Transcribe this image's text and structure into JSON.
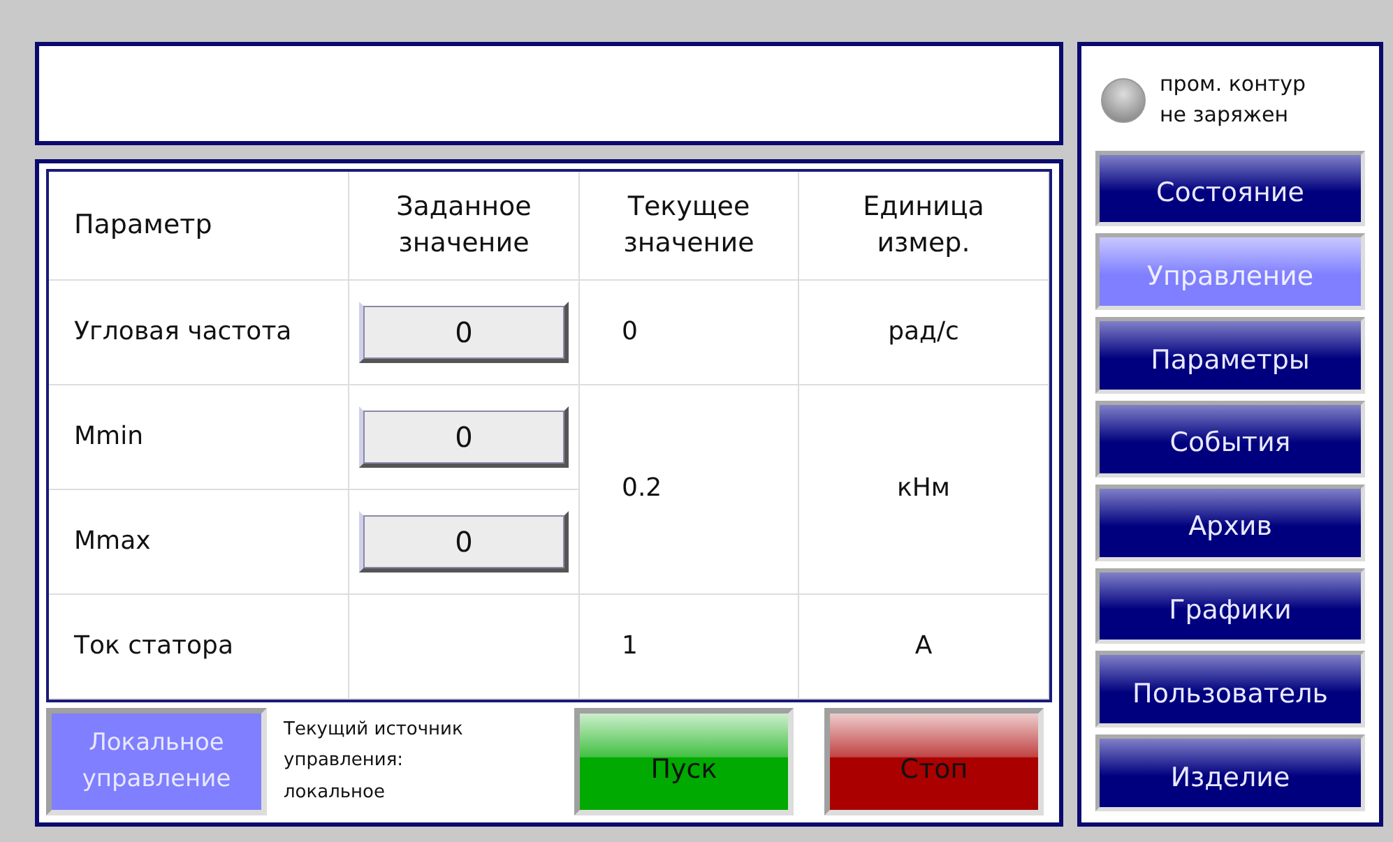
{
  "table": {
    "columns": [
      "Параметр",
      "Заданное значение",
      "Текущее значение",
      "Единица измер."
    ],
    "rows": [
      {
        "parameter": "Угловая частота",
        "setpoint": "0",
        "current": "0",
        "unit": "рад/с"
      },
      {
        "parameter": "Mmin",
        "setpoint": "0",
        "current": "0.2",
        "unit": "кНм"
      },
      {
        "parameter": "Mmax",
        "setpoint": "0"
      },
      {
        "parameter": "Ток статора",
        "current": "1",
        "unit": "А"
      }
    ]
  },
  "control_bar": {
    "local_button": {
      "label": "Локальное управление",
      "on": true
    },
    "source_text": [
      "Текущий источник",
      "управления:",
      "локальное"
    ],
    "start_button": "Пуск",
    "stop_button": "Стоп"
  },
  "indicator": {
    "lit": false,
    "label": [
      "пром. контур",
      "не заряжен"
    ]
  },
  "nav": [
    {
      "label": "Состояние",
      "selected": false
    },
    {
      "label": "Управление",
      "selected": true
    },
    {
      "label": "Параметры",
      "selected": false
    },
    {
      "label": "События",
      "selected": false
    },
    {
      "label": "Архив",
      "selected": false
    },
    {
      "label": "Графики",
      "selected": false
    },
    {
      "label": "Пользователь",
      "selected": false
    },
    {
      "label": "Изделие",
      "selected": false
    }
  ]
}
